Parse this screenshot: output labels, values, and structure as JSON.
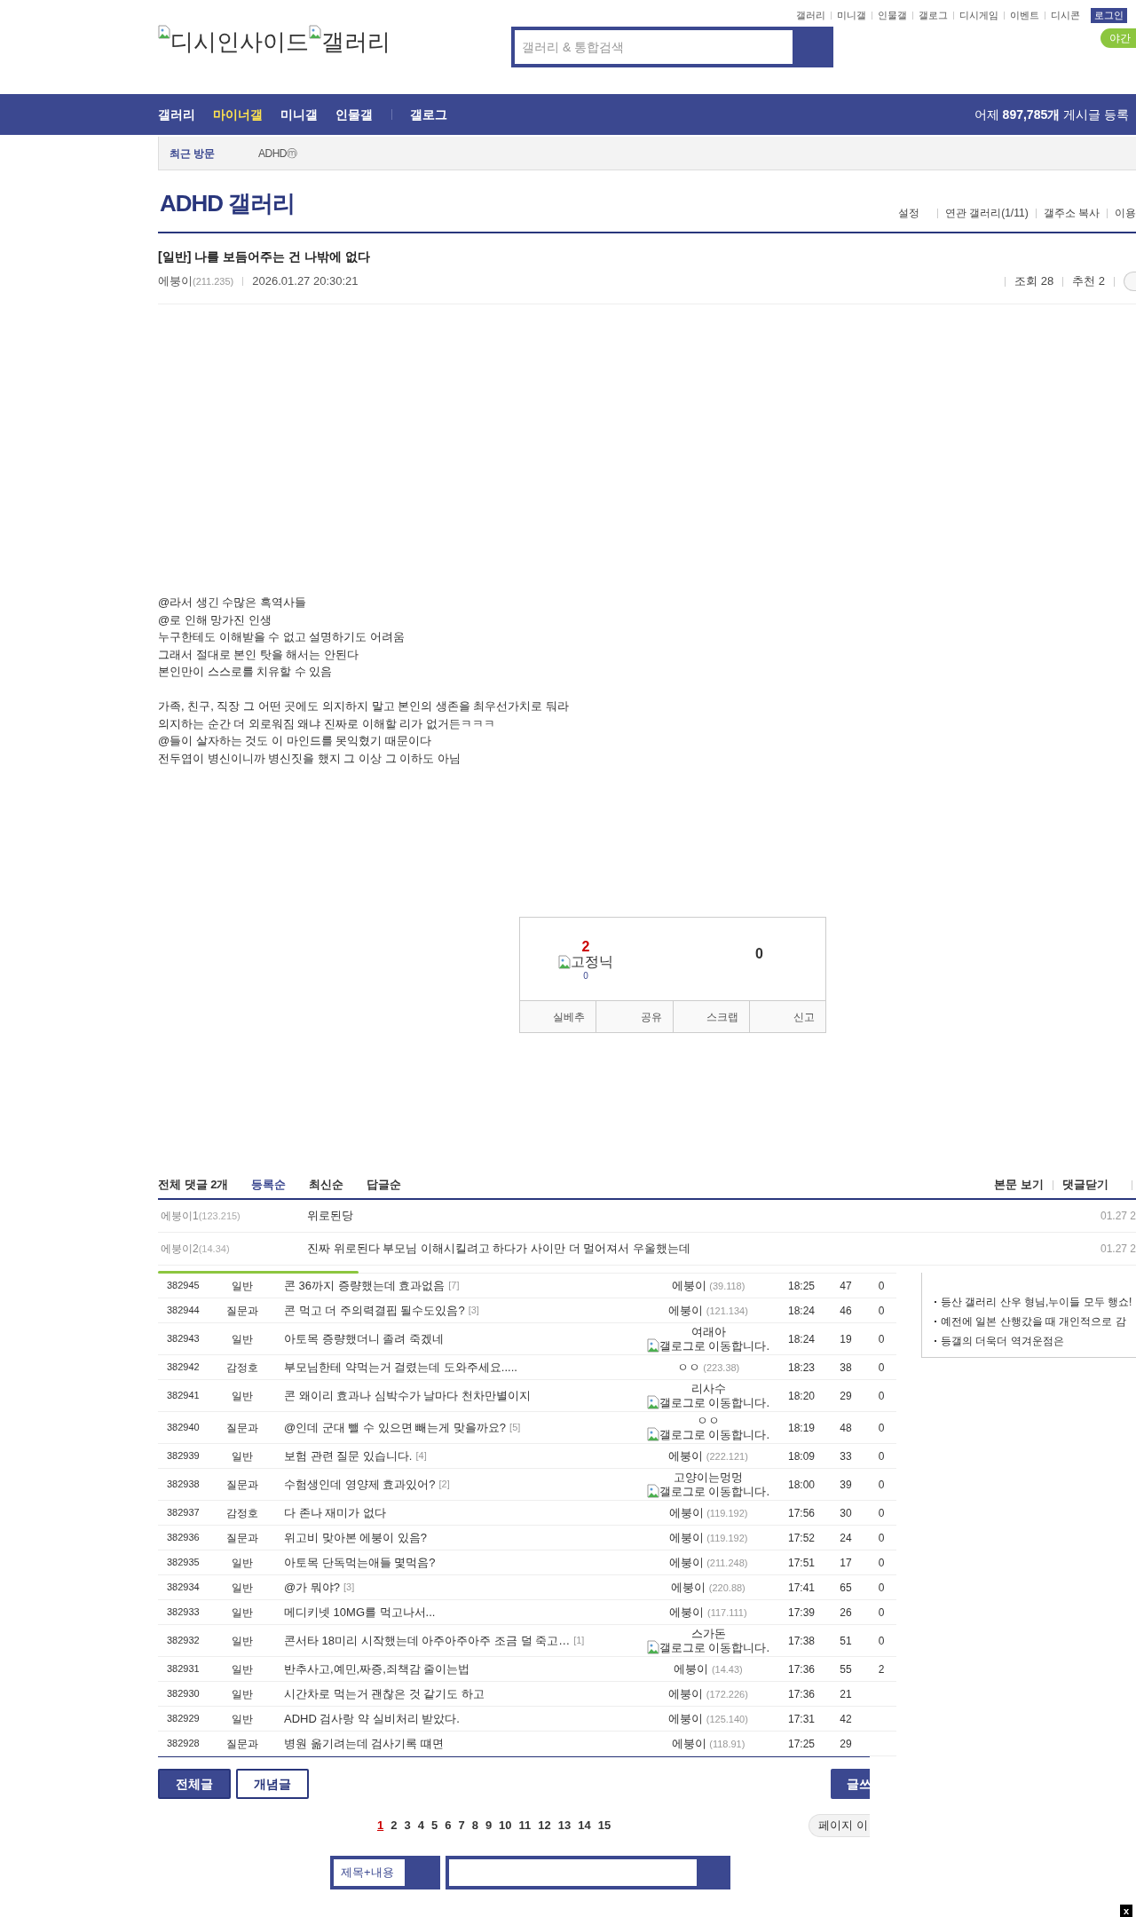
{
  "top_links": [
    "갤러리",
    "미니갤",
    "인물갤",
    "갤로그",
    "디시게임",
    "이벤트",
    "디시콘"
  ],
  "login_button": "로그인",
  "night_mode_button": "야간",
  "logo": {
    "site_alt": "디시인사이드",
    "gallery_alt": "갤러리"
  },
  "search": {
    "placeholder": "갤러리 & 통합검색"
  },
  "nav": [
    {
      "label": "갤러리",
      "selected": false
    },
    {
      "label": "마이너갤",
      "selected": true
    },
    {
      "label": "미니갤",
      "selected": false
    },
    {
      "label": "인물갤",
      "selected": false
    }
  ],
  "gallog_link": "갤로그",
  "daily_stats": "어제 **897,785개** 게시글 등록",
  "recent": {
    "label": "최근 방문",
    "items": [
      {
        "name": "ADHD",
        "mark": "ⓜ"
      }
    ]
  },
  "gallery": {
    "title": "ADHD 갤러리",
    "links": [
      "설정",
      "연관 갤러리(1/11)",
      "갤주소 복사",
      "이용"
    ]
  },
  "post": {
    "title": "[일반] 나를 보듬어주는 건 나밖에 없다",
    "author": "에붕이",
    "ip": "(211.235)",
    "date": "2026.01.27 20:30:21",
    "views": "조회 28",
    "recommends": "추천 2",
    "body": [
      [
        "@라서 생긴 수많은 흑역사들",
        "@로 인해 망가진 인생",
        "누구한테도 이해받을 수 없고 설명하기도 어려움",
        "그래서 절대로 본인 탓을 해서는 안된다",
        "본인만이 스스로를 치유할 수 있음"
      ],
      [
        "가족, 친구, 직장 그 어떤 곳에도 의지하지 말고 본인의 생존을 최우선가치로 둬라",
        "의지하는 순간 더 외로워짐 왜냐 진짜로 이해할 리가 없거든ㅋㅋㅋ",
        "@들이 살자하는 것도 이 마인드를 못익혔기 때문이다",
        "전두엽이 병신이니까 병신짓을 했지 그 이상 그 이하도 아님"
      ]
    ]
  },
  "recommend_box": {
    "up_count": "2",
    "fixed_alt": "고정닉",
    "fixed_count": "0",
    "down_count": "0",
    "actions": [
      "실베추",
      "공유",
      "스크랩",
      "신고"
    ]
  },
  "comments": {
    "title": "전체 댓글 **2**개",
    "sort_tabs": [
      {
        "label": "등록순",
        "selected": true
      },
      {
        "label": "최신순",
        "selected": false
      },
      {
        "label": "답글순",
        "selected": false
      }
    ],
    "links": [
      "본문 보기",
      "댓글닫기"
    ],
    "items": [
      {
        "author": "에붕이1",
        "ip": "(123.215)",
        "text": "위로된당",
        "date": "01.27 2"
      },
      {
        "author": "에붕이2",
        "ip": "(14.34)",
        "text": "진짜 위로된다 부모님 이해시킬려고 하다가 사이만 더 멀어져서 우울했는데",
        "date": "01.27 2"
      }
    ]
  },
  "list": {
    "rows": [
      {
        "num": "382945",
        "subject": "일반",
        "title": "콘 36까지 증량했는데 효과없음",
        "reply_count": "[7]",
        "writer": "에붕이",
        "kind": "ip",
        "ip": "(39.118)",
        "time": "18:25",
        "views": "47",
        "recs": "0"
      },
      {
        "num": "382944",
        "subject": "질문과",
        "title": "콘 먹고 더 주의력결핍 될수도있음?",
        "reply_count": "[3]",
        "writer": "에붕이",
        "kind": "ip",
        "ip": "(121.134)",
        "time": "18:24",
        "views": "46",
        "recs": "0"
      },
      {
        "num": "382943",
        "subject": "일반",
        "title": "아토목 증량했더니 졸려 죽겠네",
        "writer": "여래아",
        "kind": "gallog",
        "gallog_alt": "갤로그로 이동합니다.",
        "time": "18:24",
        "views": "19",
        "recs": "0"
      },
      {
        "num": "382942",
        "subject": "감정호",
        "title": "부모님한테 약먹는거 걸렸는데 도와주세요.....",
        "writer": "ㅇㅇ",
        "kind": "ip",
        "ip": "(223.38)",
        "time": "18:23",
        "views": "38",
        "recs": "0"
      },
      {
        "num": "382941",
        "subject": "일반",
        "title": "콘 왜이리 효과나 심박수가 날마다 천차만별이지",
        "writer": "리사수",
        "kind": "gallog",
        "gallog_alt": "갤로그로 이동합니다.",
        "time": "18:20",
        "views": "29",
        "recs": "0"
      },
      {
        "num": "382940",
        "subject": "질문과",
        "title": "@인데 군대 뺄 수 있으면 빼는게 맞을까요?",
        "reply_count": "[5]",
        "writer": "ㅇㅇ",
        "kind": "gallog",
        "gallog_alt": "갤로그로 이동합니다.",
        "time": "18:19",
        "views": "48",
        "recs": "0"
      },
      {
        "num": "382939",
        "subject": "일반",
        "title": "보험 관련 질문 있습니다.",
        "reply_count": "[4]",
        "writer": "에붕이",
        "kind": "ip",
        "ip": "(222.121)",
        "time": "18:09",
        "views": "33",
        "recs": "0"
      },
      {
        "num": "382938",
        "subject": "질문과",
        "title": "수험생인데 영양제 효과있어?",
        "reply_count": "[2]",
        "writer": "고양이는멍멍",
        "kind": "gallog",
        "gallog_alt": "갤로그로 이동합니다.",
        "time": "18:00",
        "views": "39",
        "recs": "0"
      },
      {
        "num": "382937",
        "subject": "감정호",
        "title": "다 존나 재미가 없다",
        "writer": "에붕이",
        "kind": "ip",
        "ip": "(119.192)",
        "time": "17:56",
        "views": "30",
        "recs": "0"
      },
      {
        "num": "382936",
        "subject": "질문과",
        "title": "위고비 맞아본 에붕이 있음?",
        "writer": "에붕이",
        "kind": "ip",
        "ip": "(119.192)",
        "time": "17:52",
        "views": "24",
        "recs": "0"
      },
      {
        "num": "382935",
        "subject": "일반",
        "title": "아토목 단독먹는애들 몇먹음?",
        "writer": "에붕이",
        "kind": "ip",
        "ip": "(211.248)",
        "time": "17:51",
        "views": "17",
        "recs": "0"
      },
      {
        "num": "382934",
        "subject": "일반",
        "title": "@가 뭐야?",
        "reply_count": "[3]",
        "writer": "에붕이",
        "kind": "ip",
        "ip": "(220.88)",
        "time": "17:41",
        "views": "65",
        "recs": "0"
      },
      {
        "num": "382933",
        "subject": "일반",
        "title": "메디키넷 10MG를 먹고나서...",
        "writer": "에붕이",
        "kind": "ip",
        "ip": "(117.111)",
        "time": "17:39",
        "views": "26",
        "recs": "0"
      },
      {
        "num": "382932",
        "subject": "일반",
        "title": "콘서타 18미리 시작했는데 아주아주아주 조금 덜 죽고…",
        "reply_count": "[1]",
        "writer": "스가돈",
        "kind": "gallog",
        "gallog_alt": "갤로그로 이동합니다.",
        "time": "17:38",
        "views": "51",
        "recs": "0"
      },
      {
        "num": "382931",
        "subject": "일반",
        "title": "반추사고,예민,짜증,죄책감 줄이는법",
        "writer": "에붕이",
        "kind": "ip",
        "ip": "(14.43)",
        "time": "17:36",
        "views": "55",
        "recs": "2"
      },
      {
        "num": "382930",
        "subject": "일반",
        "title": "시간차로 먹는거 괜찮은 것 같기도 하고",
        "writer": "에붕이",
        "kind": "ip",
        "ip": "(172.226)",
        "time": "17:36",
        "views": "21"
      },
      {
        "num": "382929",
        "subject": "일반",
        "title": "ADHD 검사랑 약 실비처리 받았다.",
        "writer": "에붕이",
        "kind": "ip",
        "ip": "(125.140)",
        "time": "17:31",
        "views": "42"
      },
      {
        "num": "382928",
        "subject": "질문과",
        "title": "병원 옮기려는데 검사기록 떄면",
        "writer": "에붕이",
        "kind": "ip",
        "ip": "(118.91)",
        "time": "17:25",
        "views": "29"
      }
    ]
  },
  "sidebar": {
    "items": [
      "등산 갤러리 산우 형님,누이들 모두 행쇼!",
      "예전에 일본 산행갔을 때 개인적으로 감",
      "등갤의 더욱더 역겨운점은"
    ]
  },
  "buttons": [
    "전체글",
    "개념글"
  ],
  "write_button": "글쓰",
  "pagination": {
    "pages": [
      {
        "label": "1",
        "selected": true
      },
      {
        "label": "2",
        "selected": false
      },
      {
        "label": "3",
        "selected": false
      },
      {
        "label": "4",
        "selected": false
      },
      {
        "label": "5",
        "selected": false
      },
      {
        "label": "6",
        "selected": false
      },
      {
        "label": "7",
        "selected": false
      },
      {
        "label": "8",
        "selected": false
      },
      {
        "label": "9",
        "selected": false
      },
      {
        "label": "10",
        "selected": false
      },
      {
        "label": "11",
        "selected": false
      },
      {
        "label": "12",
        "selected": false
      },
      {
        "label": "13",
        "selected": false
      },
      {
        "label": "14",
        "selected": false
      },
      {
        "label": "15",
        "selected": false
      }
    ]
  },
  "page_jump": "페이지 이",
  "bottom_search": {
    "scope": "제목+내용"
  },
  "corner_close": "x"
}
